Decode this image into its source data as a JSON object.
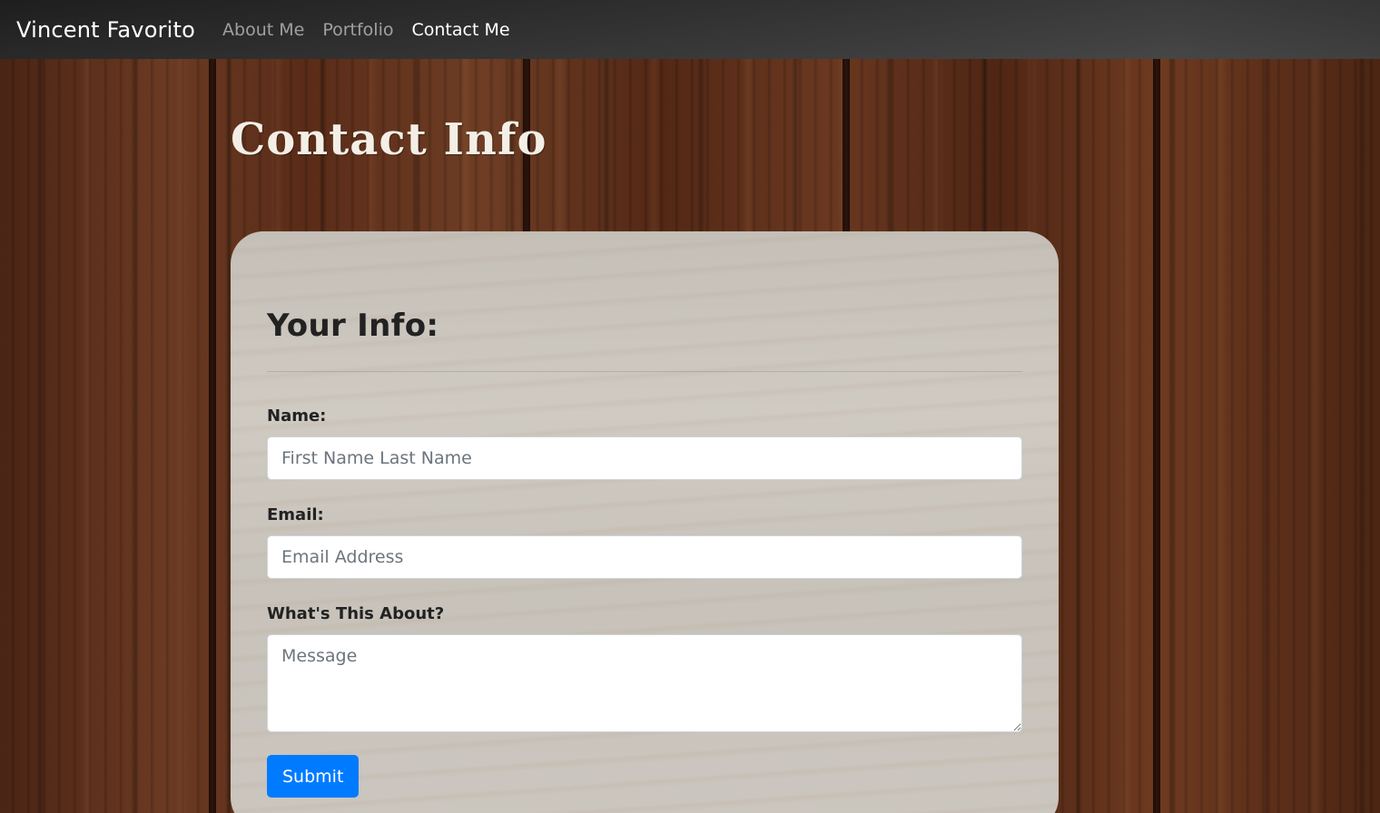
{
  "navbar": {
    "brand": "Vincent Favorito",
    "links": [
      {
        "label": "About Me",
        "active": false
      },
      {
        "label": "Portfolio",
        "active": false
      },
      {
        "label": "Contact Me",
        "active": true
      }
    ]
  },
  "page": {
    "title": "Contact Info"
  },
  "form": {
    "title": "Your Info:",
    "name_label": "Name:",
    "name_placeholder": "First Name Last Name",
    "email_label": "Email:",
    "email_placeholder": "Email Address",
    "message_label": "What's This About?",
    "message_placeholder": "Message",
    "submit_label": "Submit"
  },
  "colors": {
    "primary_button": "#007bff",
    "nav_active": "#ffffff",
    "nav_inactive": "rgba(255,255,255,0.55)"
  }
}
